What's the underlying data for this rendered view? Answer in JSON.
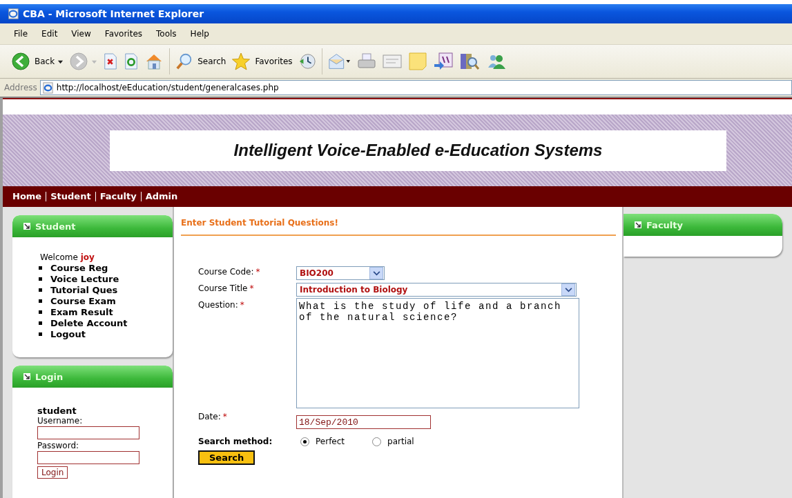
{
  "window": {
    "title": "CBA - Microsoft Internet Explorer"
  },
  "menu": [
    "File",
    "Edit",
    "View",
    "Favorites",
    "Tools",
    "Help"
  ],
  "toolbar": [
    {
      "kind": "back",
      "label": "Back"
    },
    {
      "kind": "forward"
    },
    {
      "kind": "stop"
    },
    {
      "kind": "refresh"
    },
    {
      "kind": "home"
    },
    {
      "kind": "search",
      "label": "Search"
    },
    {
      "kind": "favorites",
      "label": "Favorites"
    },
    {
      "kind": "history"
    },
    {
      "kind": "mail"
    },
    {
      "kind": "print"
    },
    {
      "kind": "edit"
    },
    {
      "kind": "note"
    },
    {
      "kind": "discuss"
    },
    {
      "kind": "research"
    },
    {
      "kind": "messenger"
    }
  ],
  "address": {
    "label": "Address",
    "url": "http://localhost/eEducation/student/generalcases.php"
  },
  "banner": {
    "title": "Intelligent Voice-Enabled e-Education Systems"
  },
  "nav": [
    "Home",
    "Student",
    "Faculty",
    "Admin"
  ],
  "student_box": {
    "title": "Student",
    "welcome": "Welcome",
    "user": "joy",
    "links": [
      "Course Reg",
      "Voice Lecture",
      "Tutorial Ques",
      "Course Exam",
      "Exam Result",
      "Delete Account",
      "Logout"
    ]
  },
  "login_box": {
    "title": "Login",
    "heading": "student",
    "username_label": "Username:",
    "password_label": "Password:",
    "button": "Login"
  },
  "form": {
    "heading": "Enter Student Tutorial Questions!",
    "fields": [
      {
        "kind": "select",
        "label": "Course Code:",
        "mark": "*",
        "value": "BIO200"
      },
      {
        "kind": "select",
        "label": "Course Title",
        "mark": "*",
        "value": "Introduction to Biology"
      },
      {
        "kind": "textarea",
        "label": "Question:",
        "mark": "*",
        "value": "What is the study of life and a branch of the natural science?"
      },
      {
        "kind": "date",
        "label": "Date:",
        "mark": "*",
        "value": "18/Sep/2010"
      }
    ],
    "search_method": {
      "label": "Search method:",
      "options": [
        {
          "label": "Perfect",
          "selected": true
        },
        {
          "label": "partial",
          "selected": false
        }
      ]
    },
    "button": "Search"
  },
  "faculty_box": {
    "title": "Faculty"
  }
}
